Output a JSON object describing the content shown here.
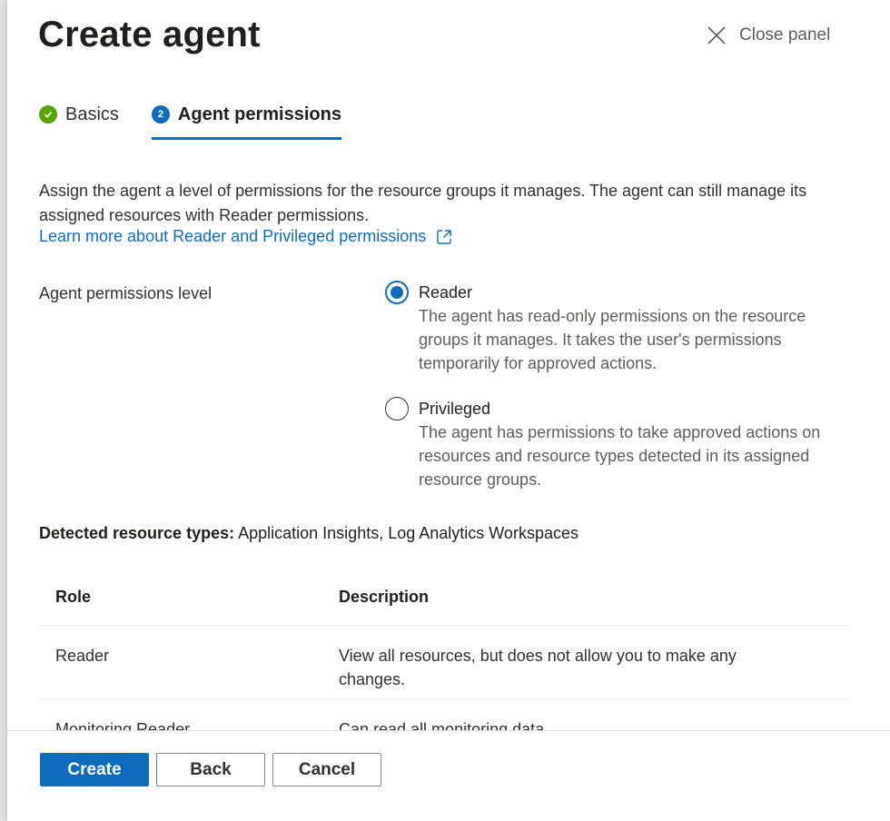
{
  "panel": {
    "title": "Create agent",
    "close_label": "Close panel"
  },
  "steps": [
    {
      "label": "Basics",
      "status": "complete",
      "icon": "check-icon"
    },
    {
      "label": "Agent permissions",
      "status": "active",
      "number": "2"
    }
  ],
  "intro": {
    "text": "Assign the agent a level of permissions for the resource groups it manages. The agent can still manage its assigned resources with Reader permissions.",
    "link_label": "Learn more about Reader and Privileged permissions",
    "link_icon": "external-link-icon"
  },
  "permissions": {
    "field_label": "Agent permissions level",
    "selected": "Reader",
    "options": [
      {
        "label": "Reader",
        "description": "The agent has read-only permissions on the resource groups it manages. It takes the user's permissions temporarily for approved actions."
      },
      {
        "label": "Privileged",
        "description": "The agent has permissions to take approved actions on resources and resource types detected in its assigned resource groups."
      }
    ]
  },
  "detected": {
    "label": "Detected resource types:",
    "value": "Application Insights, Log Analytics Workspaces"
  },
  "table": {
    "headers": [
      "Role",
      "Description"
    ],
    "rows": [
      {
        "role": "Reader",
        "description": "View all resources, but does not allow you to make any changes."
      },
      {
        "role": "Monitoring Reader",
        "description": "Can read all monitoring data."
      }
    ]
  },
  "footer": {
    "create_label": "Create",
    "back_label": "Back",
    "cancel_label": "Cancel"
  },
  "colors": {
    "accent": "#0f6cbd",
    "success": "#57a300",
    "text": "#323130",
    "muted": "#605e5c"
  }
}
